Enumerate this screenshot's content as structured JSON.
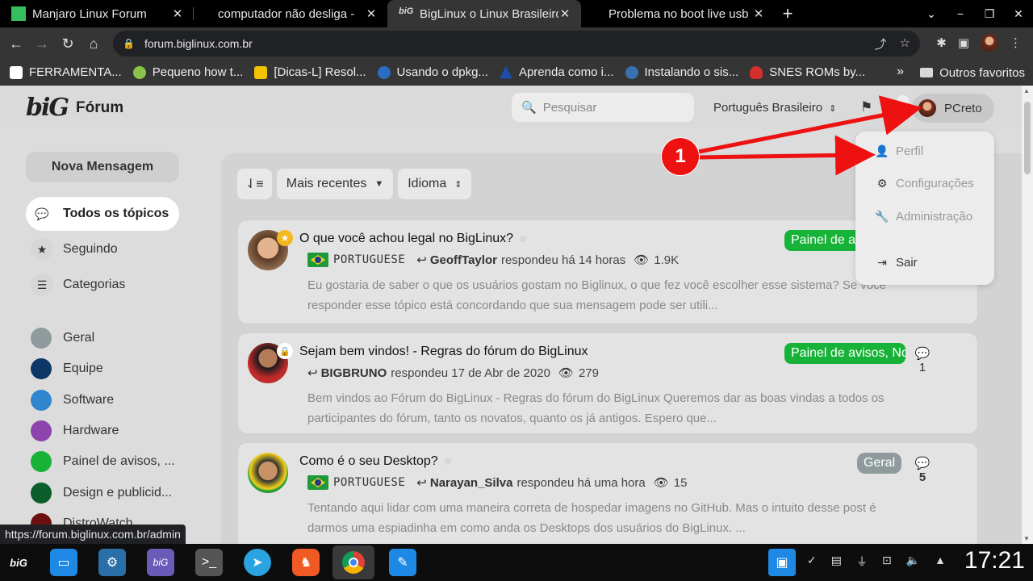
{
  "browser": {
    "tabs": [
      {
        "title": "Manjaro Linux Forum",
        "favicon_color": "#35bf5c",
        "active": false
      },
      {
        "title": "computador não desliga - ",
        "favicon_color": "#000000",
        "active": false
      },
      {
        "title": "BigLinux o Linux Brasileiro",
        "favicon_color": "#ffffff",
        "active": true
      },
      {
        "title": "Problema no boot live usb",
        "favicon_color": "#000000",
        "active": false
      }
    ],
    "new_tab": "+",
    "url": "forum.biglinux.com.br",
    "bookmarks": [
      {
        "label": "FERRAMENTA...",
        "color": "#ffffff"
      },
      {
        "label": "Pequeno how t...",
        "color": "#8bc34a"
      },
      {
        "label": "[Dicas-L] Resol...",
        "color": "#f2c200"
      },
      {
        "label": "Usando o dpkg...",
        "color": "#2b6cc4"
      },
      {
        "label": "Aprenda como i...",
        "color": "#1e4fa8"
      },
      {
        "label": "Instalando o sis...",
        "color": "#3a6fb0"
      },
      {
        "label": "SNES ROMs by...",
        "color": "#d32f2f"
      }
    ],
    "bookmarks_more": "»",
    "other_bookmarks": "Outros favoritos"
  },
  "header": {
    "logo_mark": "biG",
    "logo_text": "Fórum",
    "search_placeholder": "Pesquisar",
    "language": "Português Brasileiro",
    "username": "PCreto"
  },
  "sidebar": {
    "new_message": "Nova Mensagem",
    "nav": [
      {
        "label": "Todos os tópicos",
        "icon": "comments-icon",
        "active": true
      },
      {
        "label": "Seguindo",
        "icon": "star-icon",
        "active": false
      },
      {
        "label": "Categorias",
        "icon": "list-icon",
        "active": false
      }
    ],
    "categories": [
      {
        "label": "Geral",
        "color": "#8e9a9c"
      },
      {
        "label": "Equipe",
        "color": "#0e3666"
      },
      {
        "label": "Software",
        "color": "#2f86cf"
      },
      {
        "label": "Hardware",
        "color": "#8e44ad"
      },
      {
        "label": "Painel de avisos, ...",
        "color": "#17b338"
      },
      {
        "label": "Design e publicid...",
        "color": "#0b5e2a"
      },
      {
        "label": "DistroWatch",
        "color": "#6b0f0f"
      }
    ]
  },
  "filters": {
    "sort": "Mais recentes",
    "language": "Idioma"
  },
  "topics": [
    {
      "title": "O que você achou legal no BigLinux?",
      "lang": "PORTUGUESE",
      "user": "GeoffTaylor",
      "action": "respondeu há 14 horas",
      "views": "1.9K",
      "excerpt": "Eu gostaria de saber o que os usuários gostam no Biglinux, o que fez você escolher esse sistema? Se você responder esse tópico está concordando que sua mensagem pode ser utili...",
      "category": "Painel de avisos, No",
      "category_color": "#17b338",
      "replies": ""
    },
    {
      "title": "Sejam bem vindos! - Regras do fórum do BigLinux",
      "lang": "",
      "user": "BIGBRUNO",
      "action": "respondeu 17 de Abr de 2020",
      "views": "279",
      "excerpt": "Bem vindos ao Fórum do BigLinux - Regras do fórum do BigLinux Queremos dar as boas vindas a todos os participantes do fórum, tanto os novatos, quanto os já antigos. Espero que...",
      "category": "Painel de avisos, No",
      "category_color": "#17b338",
      "replies": "1"
    },
    {
      "title": "Como é o seu Desktop?",
      "lang": "PORTUGUESE",
      "user": "Narayan_Silva",
      "action": "respondeu há uma hora",
      "views": "15",
      "excerpt": "Tentando aqui lidar com uma maneira correta de hospedar imagens no GitHub. Mas o intuito desse post é darmos uma espiadinha em como anda os Desktops dos usuários do BigLinux. ...",
      "category": "Geral",
      "category_color": "#8e9a9c",
      "replies": "5"
    }
  ],
  "user_menu": {
    "items": [
      {
        "label": "Perfil",
        "icon": "user-icon"
      },
      {
        "label": "Configurações",
        "icon": "gear-icon"
      },
      {
        "label": "Administração",
        "icon": "wrench-icon"
      },
      {
        "label": "Sair",
        "icon": "sign-out-icon"
      }
    ]
  },
  "annotation": {
    "step": "1",
    "color": "#e11111"
  },
  "status_url": "https://forum.biglinux.com.br/admin",
  "taskbar": {
    "clock": "17:21"
  }
}
